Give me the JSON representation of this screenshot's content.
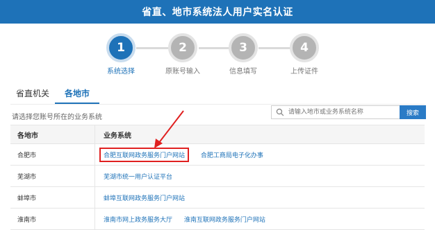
{
  "header": {
    "title": "省直、地市系统法人用户实名认证"
  },
  "steps": [
    {
      "number": "1",
      "label": "系统选择"
    },
    {
      "number": "2",
      "label": "原账号输入"
    },
    {
      "number": "3",
      "label": "信息填写"
    },
    {
      "number": "4",
      "label": "上传证件"
    }
  ],
  "tabs": [
    {
      "label": "省直机关"
    },
    {
      "label": "各地市"
    }
  ],
  "hint": "请选择您账号所在的业务系统",
  "search": {
    "placeholder": "请输入地市或业务系统名称",
    "button": "搜索"
  },
  "table": {
    "headers": [
      "各地市",
      "业务系统"
    ],
    "rows": [
      {
        "city": "合肥市",
        "systems": [
          "合肥互联网政务服务门户网站",
          "合肥工商局电子化办事"
        ]
      },
      {
        "city": "芜湖市",
        "systems": [
          "芜湖市统一用户认证平台"
        ]
      },
      {
        "city": "蚌埠市",
        "systems": [
          "蚌埠互联网政务服务门户网站"
        ]
      },
      {
        "city": "淮南市",
        "systems": [
          "淮南市网上政务服务大厅",
          "淮南互联网政务服务门户网站"
        ]
      }
    ]
  },
  "colors": {
    "primary": "#1e72b8",
    "highlight": "#e02020",
    "inactive_step": "#b4b4b4"
  }
}
